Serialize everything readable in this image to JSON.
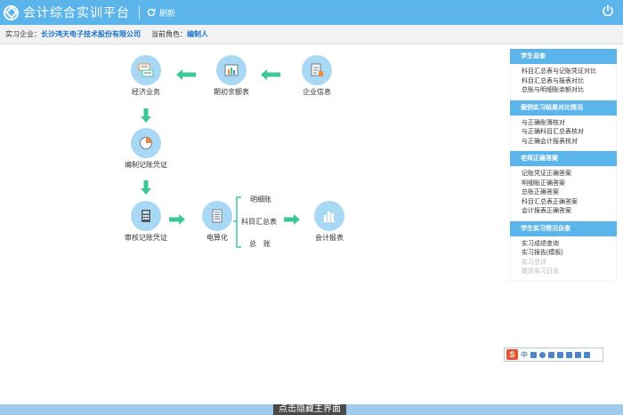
{
  "header": {
    "app_title": "会计综合实训平台",
    "refresh_label": "刷新"
  },
  "info": {
    "company_label": "实习企业：",
    "company_value": "长沙鸿天电子技术股份有限公司",
    "role_label": "当前角色：",
    "role_value": "编制人"
  },
  "flow": {
    "company_info": "企业信息",
    "opening_balance": "期初余额表",
    "business": "经济业务",
    "make_voucher": "编制记账凭证",
    "review_voucher": "审核记账凭证",
    "computerize": "电算化",
    "reports": "会计报表",
    "branch_detail": "明细账",
    "branch_summary": "科目汇总表",
    "branch_general": "总　账"
  },
  "sidebar": {
    "self_check": {
      "title": "学生自查",
      "items": [
        "科目汇总表与记账凭证对比",
        "科目汇总表与报表对比",
        "总账与明细账余额对比"
      ]
    },
    "compare": {
      "title": "案例实习结果对比情况",
      "items": [
        "与正确账簿核对",
        "与正确科目汇总表核对",
        "与正确会计报表核对"
      ]
    },
    "answers": {
      "title": "老师正确答案",
      "items": [
        "记账凭证正确答案",
        "明细账正确答案",
        "总账正确答案",
        "科目汇总表正确答案",
        "会计报表正确答案"
      ]
    },
    "report": {
      "title": "学生实习情况自查",
      "items": [
        {
          "label": "实习成绩查询",
          "dim": false
        },
        {
          "label": "实习报告(模板)",
          "dim": false
        },
        {
          "label": "实习总评",
          "dim": true
        },
        {
          "label": "提交实习日志",
          "dim": true
        }
      ]
    }
  },
  "ime": {
    "logo": "S",
    "mode": "中"
  },
  "footer": {
    "hide_main": "点击隐藏主界面"
  },
  "colors": {
    "header": "#5bb5ea",
    "icon_bg": "#a9d8f4",
    "arrow": "#3cc79a"
  }
}
